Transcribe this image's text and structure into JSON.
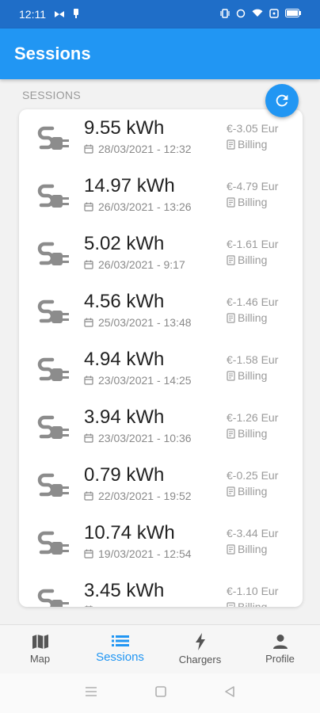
{
  "status_bar": {
    "time": "12:11"
  },
  "app_bar": {
    "title": "Sessions"
  },
  "section": {
    "label": "SESSIONS"
  },
  "sessions": [
    {
      "energy": "9.55 kWh",
      "date": "28/03/2021 - 12:32",
      "amount": "€-3.05 Eur",
      "billing": "Billing"
    },
    {
      "energy": "14.97 kWh",
      "date": "26/03/2021 - 13:26",
      "amount": "€-4.79 Eur",
      "billing": "Billing"
    },
    {
      "energy": "5.02 kWh",
      "date": "26/03/2021 - 9:17",
      "amount": "€-1.61 Eur",
      "billing": "Billing"
    },
    {
      "energy": "4.56 kWh",
      "date": "25/03/2021 - 13:48",
      "amount": "€-1.46 Eur",
      "billing": "Billing"
    },
    {
      "energy": "4.94 kWh",
      "date": "23/03/2021 - 14:25",
      "amount": "€-1.58 Eur",
      "billing": "Billing"
    },
    {
      "energy": "3.94 kWh",
      "date": "23/03/2021 - 10:36",
      "amount": "€-1.26 Eur",
      "billing": "Billing"
    },
    {
      "energy": "0.79 kWh",
      "date": "22/03/2021 - 19:52",
      "amount": "€-0.25 Eur",
      "billing": "Billing"
    },
    {
      "energy": "10.74 kWh",
      "date": "19/03/2021 - 12:54",
      "amount": "€-3.44 Eur",
      "billing": "Billing"
    },
    {
      "energy": "3.45 kWh",
      "date": "",
      "amount": "€-1.10 Eur",
      "billing": "Billing"
    }
  ],
  "bottom_nav": {
    "items": [
      {
        "label": "Map",
        "icon": "map-icon"
      },
      {
        "label": "Sessions",
        "icon": "list-icon"
      },
      {
        "label": "Chargers",
        "icon": "bolt-icon"
      },
      {
        "label": "Profile",
        "icon": "person-icon"
      }
    ],
    "active": "Sessions"
  },
  "colors": {
    "primary": "#2196f3",
    "status_bar": "#1f6ec8",
    "muted_text": "#9a9a9a",
    "plug_icon": "#8c8c8c"
  }
}
